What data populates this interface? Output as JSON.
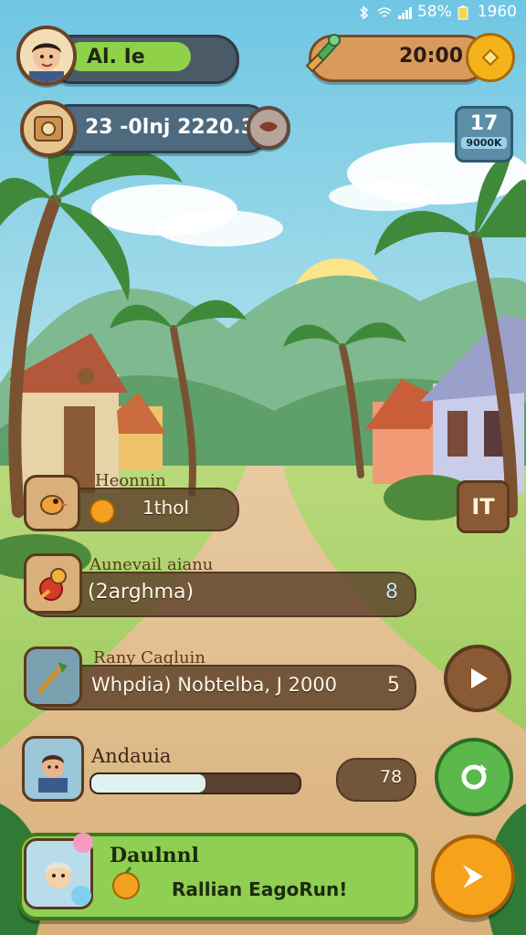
{
  "status_bar": {
    "battery": "58%",
    "time": "1960"
  },
  "player": {
    "name": "Al. Ie"
  },
  "currency": {
    "amount": "20:00"
  },
  "resource": {
    "value": "23 -0lnj 2220.30"
  },
  "day_badge": {
    "number": "17",
    "label": "9000K"
  },
  "side_button": {
    "label": "IT"
  },
  "rows": [
    {
      "title": "Heonnin",
      "text": "1thol"
    },
    {
      "title": "Aunevail aianu",
      "text": "(2arghma)",
      "count": "8"
    },
    {
      "title": "Rany Cagluin",
      "text": "Whpdia) Nobtelba, J 2000",
      "count": "5"
    },
    {
      "title": "Andauia",
      "count": "78",
      "progress": 0.55
    }
  ],
  "banner": {
    "title": "Daulnnl",
    "subtitle": "Rallian EagoRun!"
  },
  "colors": {
    "accent_green": "#7cc044",
    "wood": "#6b4323",
    "orange": "#f39a1a",
    "sky": "#bfe7f0"
  },
  "icons": [
    "avatar",
    "compass-icon",
    "coin-icon",
    "map-icon",
    "shield-icon",
    "play-icon",
    "refresh-icon",
    "next-icon",
    "fruit-icon"
  ]
}
